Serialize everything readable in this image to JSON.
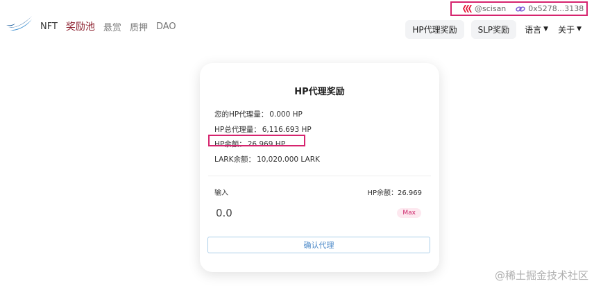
{
  "account": {
    "username": "@scisan",
    "address": "0x5278...3138"
  },
  "nav": {
    "items": [
      {
        "label": "NFT"
      },
      {
        "label": "奖励池"
      },
      {
        "label": "悬赏"
      },
      {
        "label": "质押"
      },
      {
        "label": "DAO"
      }
    ],
    "right": {
      "hp_reward": "HP代理奖励",
      "slp_reward": "SLP奖励",
      "language": "语言",
      "about": "关于"
    }
  },
  "card": {
    "title": "HP代理奖励",
    "stats": [
      {
        "label": "您的HP代理量：",
        "value": "0.000 HP"
      },
      {
        "label": "HP总代理量：",
        "value": "6,116.693 HP"
      },
      {
        "label": "HP余额：",
        "value": "26.969 HP"
      },
      {
        "label": "LARK余额：",
        "value": "10,020.000 LARK"
      }
    ],
    "input_label": "输入",
    "balance_label": "HP余额：26.969",
    "input_value": "0.0",
    "max_label": "Max",
    "confirm_label": "确认代理"
  },
  "watermark": "@稀土掘金技术社区",
  "colors": {
    "highlight": "#d6246e",
    "active_nav": "#8b1d2c",
    "confirm_text": "#4a88c8"
  }
}
